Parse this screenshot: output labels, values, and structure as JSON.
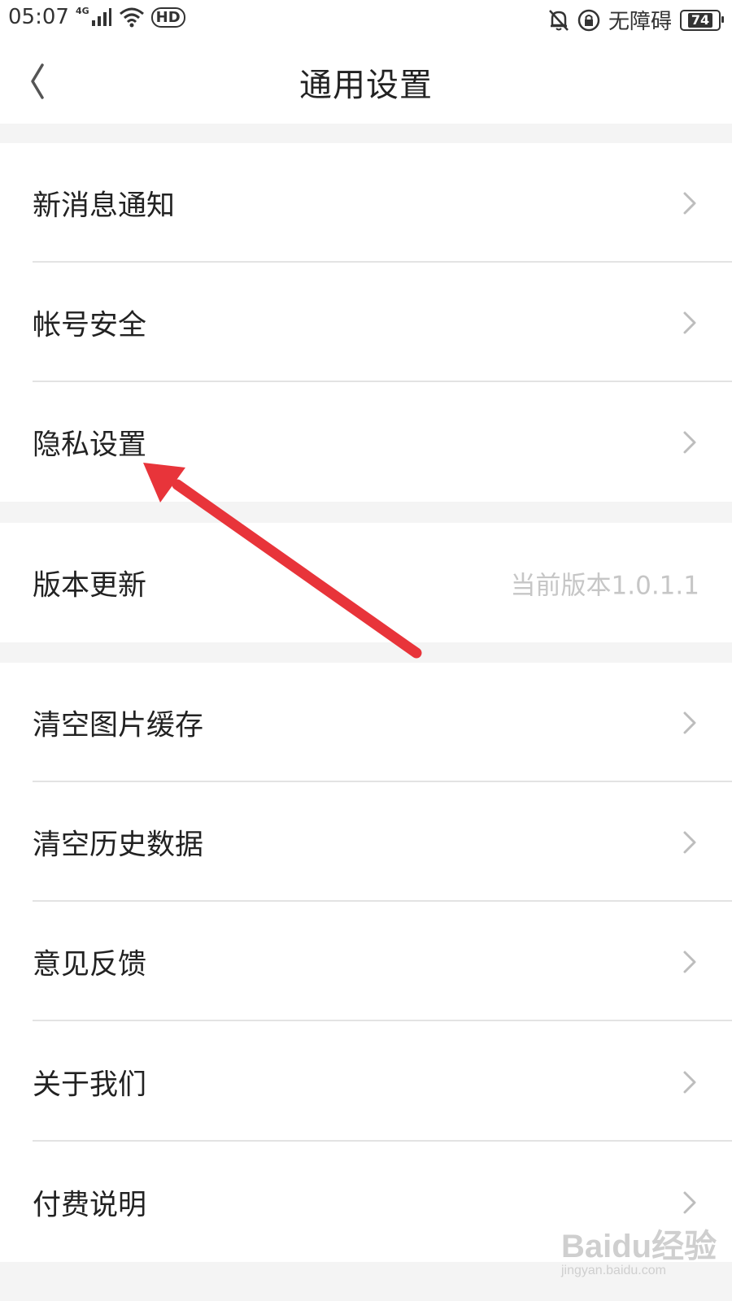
{
  "status_bar": {
    "time": "05:07",
    "network": "4G",
    "hd": "HD",
    "accessibility": "无障碍",
    "battery": "74"
  },
  "nav": {
    "title": "通用设置",
    "back_icon": "chevron-left-icon"
  },
  "groups": [
    {
      "items": [
        {
          "label": "新消息通知"
        },
        {
          "label": "帐号安全"
        },
        {
          "label": "隐私设置"
        }
      ]
    },
    {
      "items": [
        {
          "label": "版本更新",
          "value": "当前版本1.0.1.1"
        }
      ]
    },
    {
      "items": [
        {
          "label": "清空图片缓存"
        },
        {
          "label": "清空历史数据"
        },
        {
          "label": "意见反馈"
        },
        {
          "label": "关于我们"
        },
        {
          "label": "付费说明"
        }
      ]
    }
  ],
  "annotation": {
    "color": "#e8343a",
    "icon": "red-arrow"
  },
  "watermark": {
    "brand": "Baidu经验",
    "url": "jingyan.baidu.com"
  },
  "colors": {
    "background": "#ffffff",
    "section_gap": "#f4f4f4",
    "divider": "#e3e3e3",
    "muted_text": "#c6c6c6"
  }
}
